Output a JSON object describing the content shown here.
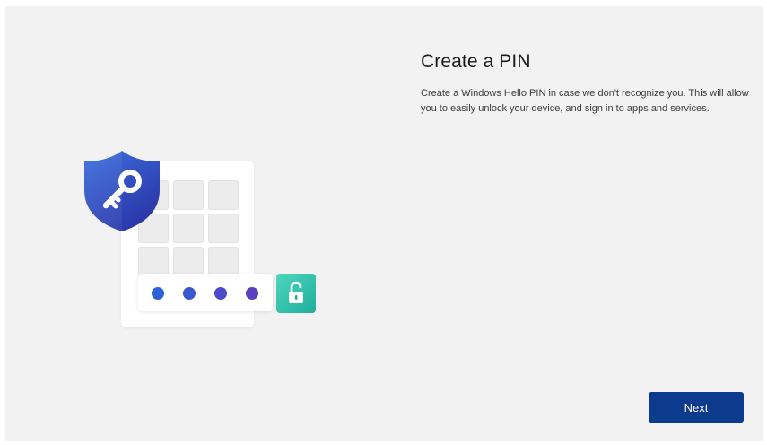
{
  "page": {
    "title": "Create a PIN",
    "description": "Create a Windows Hello PIN in case we don't recognize you. This will allow you to easily unlock your device, and sign in to apps and services."
  },
  "illustration": {
    "shield_icon": "shield-key-icon",
    "lock_icon": "unlocked-padlock-icon",
    "pin_dot_count": 4,
    "keypad_key_count": 9
  },
  "actions": {
    "next_label": "Next"
  },
  "colors": {
    "background": "#f2f2f2",
    "accent_button": "#0c3a8c",
    "shield_top": "#3a63d8",
    "shield_bottom": "#2b3fb0",
    "lock_badge": "#2cc3aa",
    "pin_dots": [
      "#2f62d6",
      "#3a57d0",
      "#4a4bc8",
      "#5a40c0"
    ]
  }
}
